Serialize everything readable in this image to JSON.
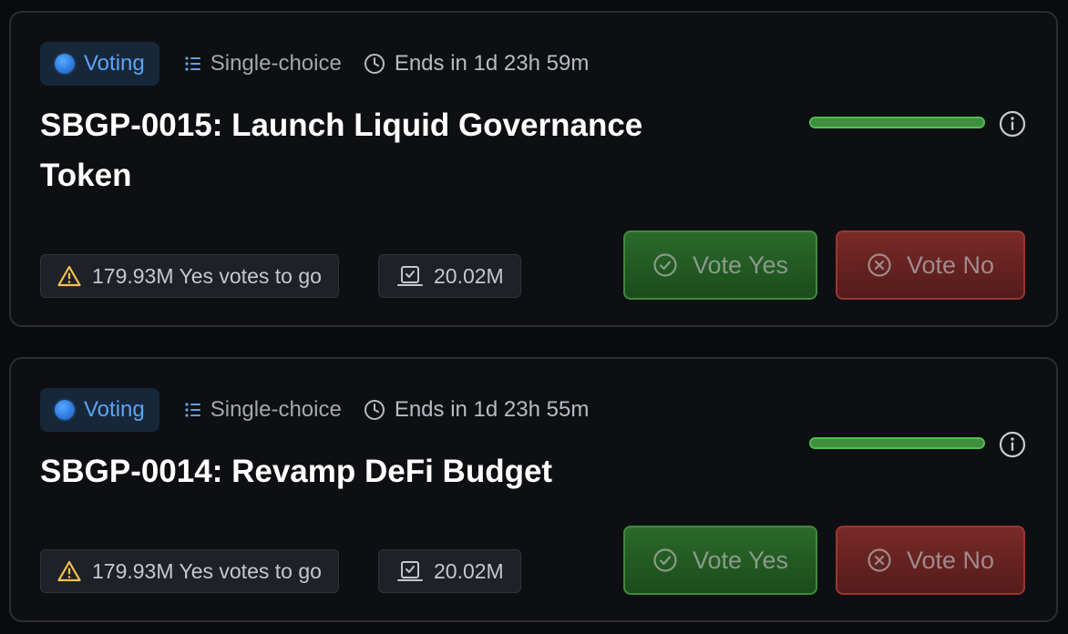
{
  "colors": {
    "voting_blue": "#5ba4f5",
    "progress_green": "#4fc14f",
    "warning_yellow": "#f2c14e",
    "yes_green": "#2a6a2a",
    "no_red": "#7a2a28"
  },
  "proposals": [
    {
      "status": "Voting",
      "voting_type": "Single-choice",
      "ends_in": "Ends in 1d 23h 59m",
      "title": "SBGP-0015: Launch Liquid Governance Token",
      "progress_fraction": 1.0,
      "votes_to_go": "179.93M Yes votes to go",
      "voting_power": "20.02M",
      "vote_yes_label": "Vote Yes",
      "vote_no_label": "Vote No",
      "icons": {
        "status": "status-dot-icon",
        "type": "list-icon",
        "time": "clock-icon",
        "info": "info-icon",
        "warning": "warning-icon",
        "power": "ballot-box-icon",
        "yes": "check-circle-icon",
        "no": "x-circle-icon"
      }
    },
    {
      "status": "Voting",
      "voting_type": "Single-choice",
      "ends_in": "Ends in 1d 23h 55m",
      "title": "SBGP-0014: Revamp DeFi Budget",
      "progress_fraction": 1.0,
      "votes_to_go": "179.93M Yes votes to go",
      "voting_power": "20.02M",
      "vote_yes_label": "Vote Yes",
      "vote_no_label": "Vote No",
      "icons": {
        "status": "status-dot-icon",
        "type": "list-icon",
        "time": "clock-icon",
        "info": "info-icon",
        "warning": "warning-icon",
        "power": "ballot-box-icon",
        "yes": "check-circle-icon",
        "no": "x-circle-icon"
      }
    }
  ]
}
